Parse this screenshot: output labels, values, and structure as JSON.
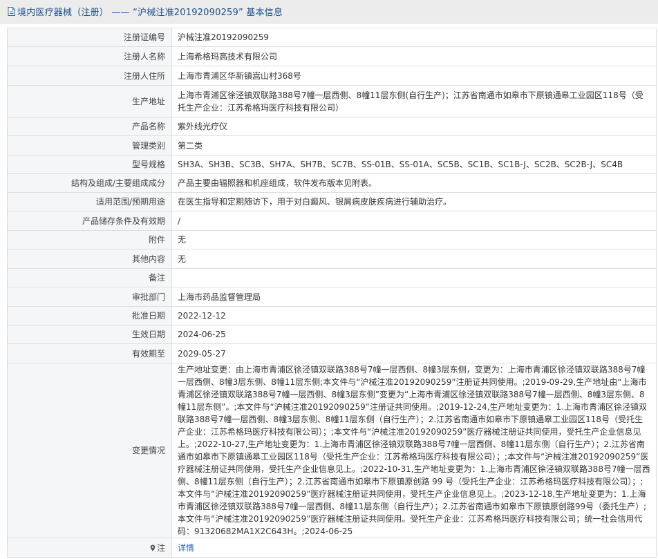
{
  "header": {
    "icon": "document-icon",
    "title": "境内医疗器械（注册） —— “沪械注准20192090259” 基本信息"
  },
  "rows": [
    {
      "label": "注册证编号",
      "value": "沪械注准20192090259"
    },
    {
      "label": "注册人名称",
      "value": "上海希格玛高技术有限公司"
    },
    {
      "label": "注册人住所",
      "value": "上海市青浦区华新镇嵩山村368号"
    },
    {
      "label": "生产地址",
      "value": "上海市青浦区徐泾镇双联路388号7幢一层西侧、8幢11层东侧(自行生产)；江苏省南通市如皋市下原镇通皋工业园区118号（受托生产企业：江苏希格玛医疗科技有限公司）"
    },
    {
      "label": "产品名称",
      "value": "紫外线光疗仪"
    },
    {
      "label": "管理类别",
      "value": "第二类"
    },
    {
      "label": "型号规格",
      "value": "SH3A、SH3B、SC3B、SH7A、SH7B、SC7B、SS-01B、SS-01A、SC5B、SC1B、SC1B-J、SC2B、SC2B-J、SC4B"
    },
    {
      "label": "结构及组成/主要组成成分",
      "value": "产品主要由辐照器和机座组成，软件发布版本见附表。"
    },
    {
      "label": "适用范围/预期用途",
      "value": "在医生指导和定期随访下，用于对白癜风、银屑病皮肤疾病进行辅助治疗。"
    },
    {
      "label": "产品储存条件及有效期",
      "value": "/"
    },
    {
      "label": "附件",
      "value": "无"
    },
    {
      "label": "其他内容",
      "value": "无"
    },
    {
      "label": "备注",
      "value": ""
    },
    {
      "label": "审批部门",
      "value": "上海市药品监督管理局"
    },
    {
      "label": "批准日期",
      "value": "2022-12-12"
    },
    {
      "label": "生效日期",
      "value": "2024-06-25"
    },
    {
      "label": "有效期至",
      "value": "2029-05-27"
    },
    {
      "label": "变更情况",
      "value": "生产地址变更：由上海市青浦区徐泾镇双联路388号7幢一层西侧、8幢3层东侧，变更为：上海市青浦区徐泾镇双联路388号7幢一层西侧、8幢3层东侧、8幢11层东侧;本文件与“沪械注准20192090259”注册证共同使用。;2019-09-29,生产地址由“上海市青浦区徐泾镇双联路388号7幢一层西侧、8幢3层东侧”变更为“上海市青浦区徐泾镇双联路388号7幢一层西侧、8幢3层东侧、8幢11层东侧”。;本文件与“沪械注准20192090259”注册证共同使用。;2019-12-24,生产地址变更为：1.上海市青浦区徐泾镇双联路388号7幢一层西侧、8幢3层东侧、8幢11层东侧（自行生产）；2.江苏省南通市如皋市下原镇通皋工业园区118号（受托生产企业：江苏希格玛医疗科技有限公司）；;本文件与“沪械注准20192090259”医疗器械注册证共同使用，受托生产企业信息见上。;2022-10-27,生产地址变更为：1.上海市青浦区徐泾镇双联路388号7幢一层西侧、8幢11层东侧（自行生产）；2.江苏省南通市如皋市下原镇通皋工业园区118号（受托生产企业：江苏希格玛医疗科技有限公司）；;本文件与“沪械注准20192090259”医疗器械注册证共同使用，受托生产企业信息见上。;2022-10-31,生产地址变更为：1.上海市青浦区徐泾镇双联路388号7幢一层西侧、8幢11层东侧（自行生产）；2.江苏省南通市如皋市下原镇原创路 99 号（受托生产企业：江苏希格玛医疗科技有限公司）；;本文件与“沪械注准20192090259”医疗器械注册证共同使用，受托生产企业信息见上。;2023-12-18,生产地址变更为：1.上海市青浦区徐泾镇双联路388号7幢一层西侧、8幢11层东侧（自行生产）；2.江苏省南通市如皋市下原镇原创路99号（委托生产）;本文件与“沪械注准20192090259”医疗器械注册证共同使用。受托生产企业：江苏希格玛医疗科技有限公司；统一社会信用代码：91320682MA1X2C643H。;2024-06-25"
    }
  ],
  "note": {
    "icon": "location-pin-icon",
    "label": "注",
    "link": "详情"
  }
}
